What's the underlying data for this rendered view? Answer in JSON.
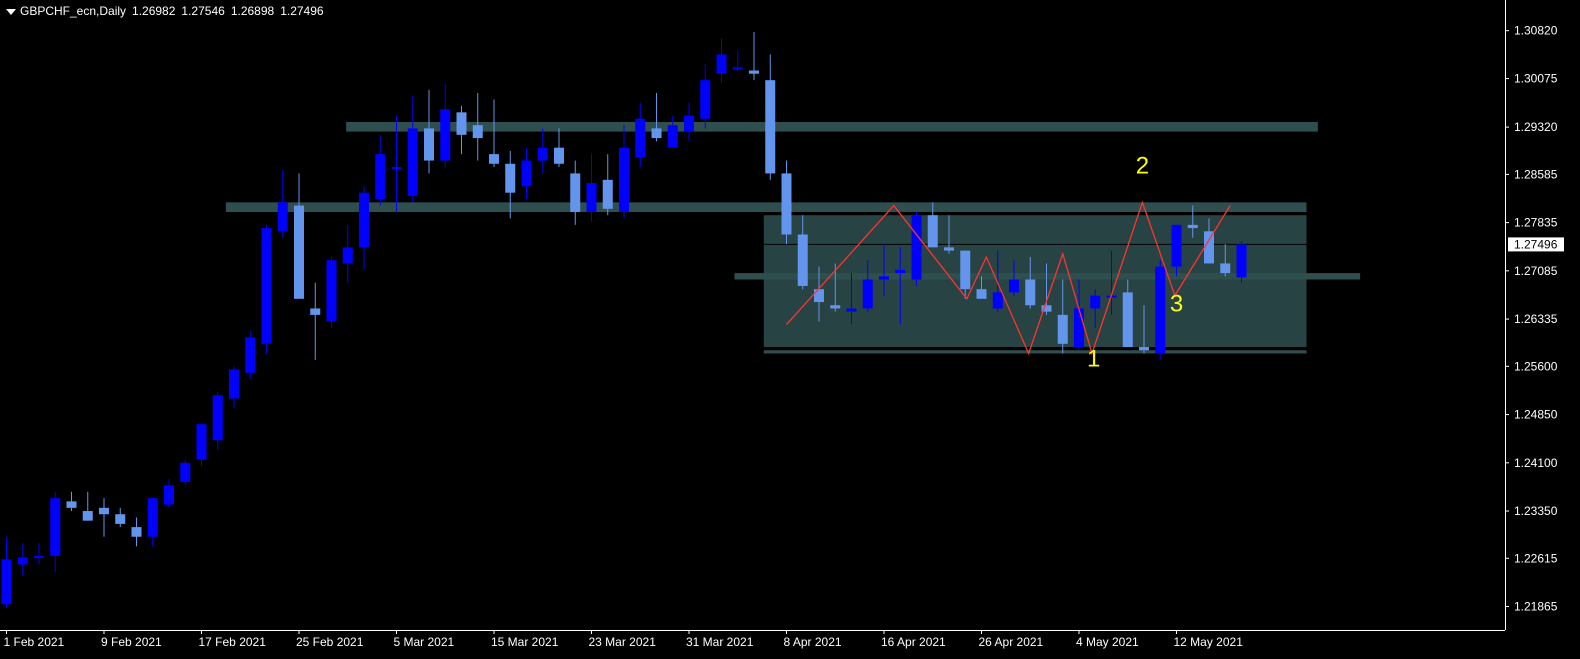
{
  "header": {
    "symbol": "GBPCHF_ecn,Daily",
    "open": "1.26982",
    "high": "1.27546",
    "low": "1.26898",
    "close": "1.27496"
  },
  "chart_data": {
    "type": "candlestick",
    "symbol": "GBPCHF_ecn",
    "timeframe": "Daily",
    "ylim": [
      1.215,
      1.3125
    ],
    "y_ticks": [
      "1.30820",
      "1.30075",
      "1.29320",
      "1.28585",
      "1.27835",
      "1.27085",
      "1.26335",
      "1.25600",
      "1.24850",
      "1.24100",
      "1.23350",
      "1.22615",
      "1.21865"
    ],
    "x_ticks": [
      {
        "index": 0,
        "label": "1 Feb 2021"
      },
      {
        "index": 6,
        "label": "9 Feb 2021"
      },
      {
        "index": 12,
        "label": "17 Feb 2021"
      },
      {
        "index": 18,
        "label": "25 Feb 2021"
      },
      {
        "index": 24,
        "label": "5 Mar 2021"
      },
      {
        "index": 30,
        "label": "15 Mar 2021"
      },
      {
        "index": 36,
        "label": "23 Mar 2021"
      },
      {
        "index": 42,
        "label": "31 Mar 2021"
      },
      {
        "index": 48,
        "label": "8 Apr 2021"
      },
      {
        "index": 54,
        "label": "16 Apr 2021"
      },
      {
        "index": 60,
        "label": "26 Apr 2021"
      },
      {
        "index": 66,
        "label": "4 May 2021"
      },
      {
        "index": 72,
        "label": "12 May 2021"
      }
    ],
    "current_price": "1.27496",
    "colors": {
      "bull": "#0000ff",
      "bear": "#6495ed",
      "zone": "#2f4f4f",
      "zigzag": "#ff3333",
      "marker": "#ffff00",
      "current_line": "#c0c0c0"
    },
    "candles": [
      [
        1.219,
        1.2295,
        1.2185,
        1.226
      ],
      [
        1.2252,
        1.2285,
        1.2235,
        1.2263
      ],
      [
        1.2265,
        1.2285,
        1.2252,
        1.2265
      ],
      [
        1.2265,
        1.2365,
        1.224,
        1.2355
      ],
      [
        1.235,
        1.2365,
        1.2335,
        1.234
      ],
      [
        1.2335,
        1.2365,
        1.232,
        1.232
      ],
      [
        1.234,
        1.2355,
        1.2295,
        1.233
      ],
      [
        1.233,
        1.234,
        1.231,
        1.2315
      ],
      [
        1.231,
        1.2325,
        1.228,
        1.2295
      ],
      [
        1.2295,
        1.2355,
        1.228,
        1.2355
      ],
      [
        1.2345,
        1.2385,
        1.234,
        1.2375
      ],
      [
        1.238,
        1.2415,
        1.2375,
        1.241
      ],
      [
        1.2415,
        1.2465,
        1.2405,
        1.247
      ],
      [
        1.2445,
        1.252,
        1.243,
        1.2515
      ],
      [
        1.251,
        1.256,
        1.2495,
        1.2555
      ],
      [
        1.255,
        1.2615,
        1.254,
        1.2605
      ],
      [
        1.2595,
        1.278,
        1.258,
        1.2775
      ],
      [
        1.277,
        1.2865,
        1.276,
        1.2815
      ],
      [
        1.281,
        1.286,
        1.279,
        1.2665
      ],
      [
        1.265,
        1.269,
        1.257,
        1.264
      ],
      [
        1.263,
        1.273,
        1.262,
        1.2725
      ],
      [
        1.272,
        1.278,
        1.269,
        1.2745
      ],
      [
        1.2745,
        1.284,
        1.271,
        1.283
      ],
      [
        1.282,
        1.292,
        1.281,
        1.289
      ],
      [
        1.287,
        1.295,
        1.28,
        1.287
      ],
      [
        1.2825,
        1.298,
        1.2815,
        1.293
      ],
      [
        1.293,
        1.299,
        1.286,
        1.288
      ],
      [
        1.288,
        1.3,
        1.287,
        1.296
      ],
      [
        1.2955,
        1.2965,
        1.289,
        1.292
      ],
      [
        1.2935,
        1.2985,
        1.288,
        1.2915
      ],
      [
        1.289,
        1.2975,
        1.287,
        1.2875
      ],
      [
        1.2875,
        1.2895,
        1.279,
        1.283
      ],
      [
        1.284,
        1.29,
        1.282,
        1.288
      ],
      [
        1.288,
        1.293,
        1.286,
        1.29
      ],
      [
        1.29,
        1.293,
        1.287,
        1.2875
      ],
      [
        1.286,
        1.288,
        1.278,
        1.28
      ],
      [
        1.28,
        1.289,
        1.2785,
        1.2845
      ],
      [
        1.285,
        1.289,
        1.2795,
        1.2805
      ],
      [
        1.28,
        1.2935,
        1.279,
        1.29
      ],
      [
        1.2885,
        1.297,
        1.287,
        1.2945
      ],
      [
        1.293,
        1.2985,
        1.291,
        1.2915
      ],
      [
        1.29,
        1.295,
        1.29,
        1.2935
      ],
      [
        1.2925,
        1.297,
        1.291,
        1.295
      ],
      [
        1.2945,
        1.303,
        1.293,
        1.3005
      ],
      [
        1.3015,
        1.307,
        1.3,
        1.3045
      ],
      [
        1.3025,
        1.305,
        1.302,
        1.3025
      ],
      [
        1.302,
        1.308,
        1.3005,
        1.3015
      ],
      [
        1.3005,
        1.3045,
        1.285,
        1.286
      ],
      [
        1.286,
        1.288,
        1.275,
        1.2765
      ],
      [
        1.2765,
        1.2795,
        1.268,
        1.2685
      ],
      [
        1.268,
        1.2715,
        1.263,
        1.266
      ],
      [
        1.2655,
        1.272,
        1.2645,
        1.265
      ],
      [
        1.2645,
        1.2705,
        1.2625,
        1.265
      ],
      [
        1.265,
        1.2725,
        1.2645,
        1.2695
      ],
      [
        1.2695,
        1.275,
        1.267,
        1.27
      ],
      [
        1.2705,
        1.2745,
        1.2625,
        1.271
      ],
      [
        1.2695,
        1.28,
        1.2685,
        1.2795
      ],
      [
        1.2795,
        1.2815,
        1.2765,
        1.2745
      ],
      [
        1.2745,
        1.2795,
        1.2735,
        1.274
      ],
      [
        1.274,
        1.274,
        1.2665,
        1.268
      ],
      [
        1.268,
        1.27,
        1.2665,
        1.2665
      ],
      [
        1.265,
        1.274,
        1.2645,
        1.2675
      ],
      [
        1.2675,
        1.2725,
        1.267,
        1.2695
      ],
      [
        1.2695,
        1.273,
        1.265,
        1.2655
      ],
      [
        1.2655,
        1.272,
        1.264,
        1.2645
      ],
      [
        1.264,
        1.2695,
        1.258,
        1.2595
      ],
      [
        1.259,
        1.2695,
        1.2585,
        1.265
      ],
      [
        1.265,
        1.268,
        1.262,
        1.267
      ],
      [
        1.267,
        1.274,
        1.264,
        1.267
      ],
      [
        1.2675,
        1.2695,
        1.2595,
        1.259
      ],
      [
        1.259,
        1.2655,
        1.258,
        1.2585
      ],
      [
        1.258,
        1.2725,
        1.257,
        1.2715
      ],
      [
        1.2715,
        1.278,
        1.27,
        1.278
      ],
      [
        1.278,
        1.281,
        1.276,
        1.2775
      ],
      [
        1.277,
        1.279,
        1.272,
        1.272
      ],
      [
        1.272,
        1.275,
        1.27,
        1.2705
      ],
      [
        1.26982,
        1.27546,
        1.26898,
        1.27496
      ]
    ],
    "zones": [
      {
        "kind": "band",
        "from_index": 20.9,
        "to_index": 80.7,
        "y_top": 1.294,
        "y_bottom": 1.2925
      },
      {
        "kind": "band",
        "from_index": 13.5,
        "to_index": 80.0,
        "y_top": 1.2815,
        "y_bottom": 1.28
      },
      {
        "kind": "band",
        "from_index": 44.8,
        "to_index": 83.3,
        "y_top": 1.2705,
        "y_bottom": 1.2695
      },
      {
        "kind": "box",
        "from_index": 46.6,
        "to_index": 80.0,
        "y_top": 1.2795,
        "y_bottom": 1.259
      },
      {
        "kind": "band",
        "from_index": 46.6,
        "to_index": 80.0,
        "y_top": 1.2585,
        "y_bottom": 1.258
      }
    ],
    "zigzag": [
      [
        48.0,
        1.2625
      ],
      [
        54.6,
        1.281
      ],
      [
        59.1,
        1.2665
      ],
      [
        60.3,
        1.273
      ],
      [
        62.9,
        1.258
      ],
      [
        65.0,
        1.2735
      ],
      [
        66.8,
        1.258
      ],
      [
        69.9,
        1.2815
      ],
      [
        71.9,
        1.267
      ],
      [
        75.3,
        1.281
      ]
    ],
    "labels": [
      {
        "text": "1",
        "at_index": 66.9,
        "at_price": 1.256
      },
      {
        "text": "2",
        "at_index": 69.9,
        "at_price": 1.286
      },
      {
        "text": "3",
        "at_index": 72.0,
        "at_price": 1.2645
      }
    ]
  }
}
